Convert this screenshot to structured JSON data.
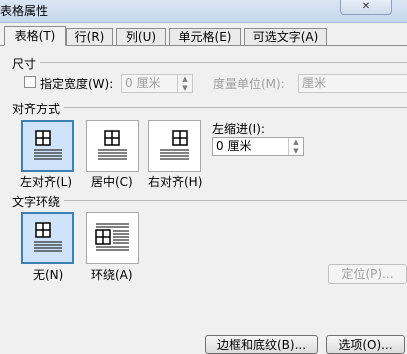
{
  "window": {
    "title": "表格属性",
    "close_glyph": "✕"
  },
  "tabs": [
    {
      "label": "表格(T)"
    },
    {
      "label": "行(R)"
    },
    {
      "label": "列(U)"
    },
    {
      "label": "单元格(E)"
    },
    {
      "label": "可选文字(A)"
    }
  ],
  "size": {
    "section": "尺寸",
    "preferred_width_label": "指定宽度(W):",
    "width_value": "0 厘米",
    "unit_label": "度量单位(M):",
    "unit_value": "厘米"
  },
  "alignment": {
    "section": "对齐方式",
    "options": [
      {
        "label": "左对齐(L)",
        "selected": true
      },
      {
        "label": "居中(C)",
        "selected": false
      },
      {
        "label": "右对齐(H)",
        "selected": false
      }
    ],
    "indent_label": "左缩进(I):",
    "indent_value": "0 厘米"
  },
  "wrapping": {
    "section": "文字环绕",
    "options": [
      {
        "label": "无(N)",
        "selected": true
      },
      {
        "label": "环绕(A)",
        "selected": false
      }
    ],
    "positioning_label": "定位(P)..."
  },
  "footer": {
    "borders_label": "边框和底纹(B)...",
    "options_label": "选项(O)..."
  }
}
